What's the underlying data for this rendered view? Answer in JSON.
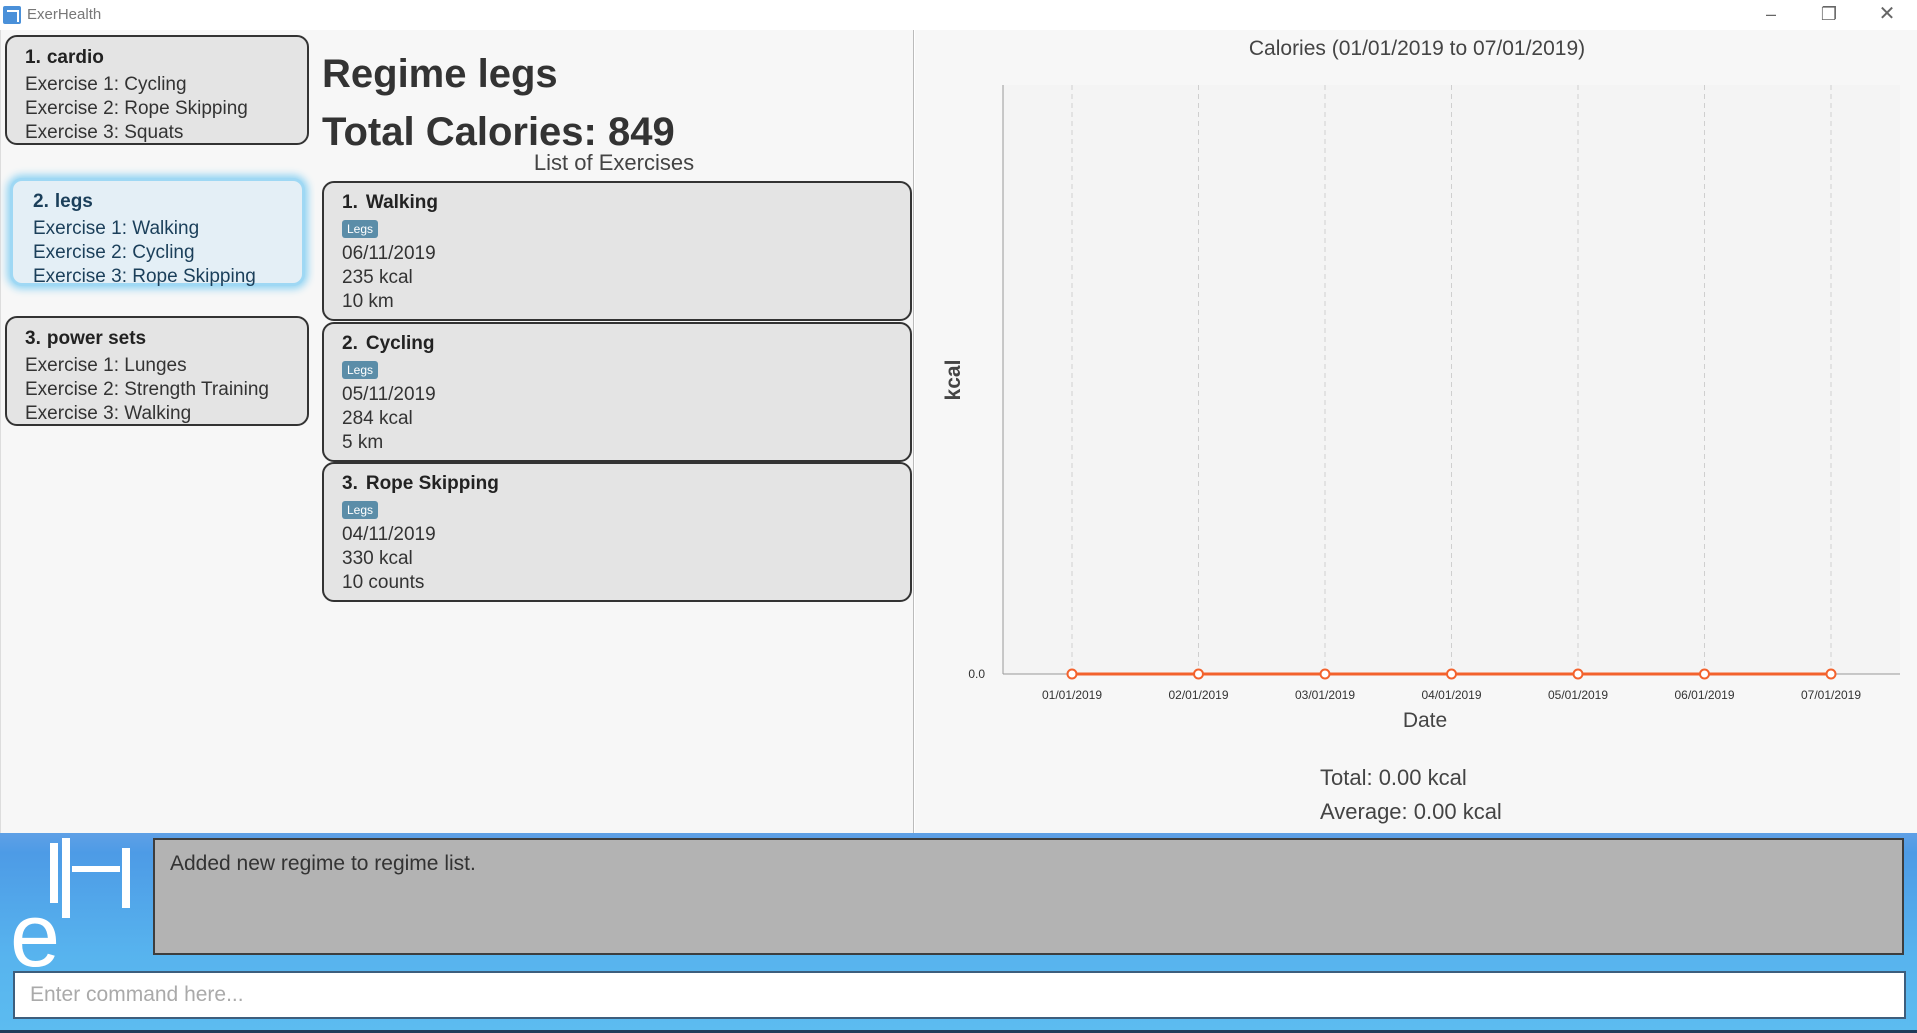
{
  "window": {
    "title": "ExerHealth",
    "minimize": "–",
    "maximize": "❐",
    "close": "✕"
  },
  "regimes": [
    {
      "num": "1.",
      "name": "cardio",
      "exercises": [
        "Exercise 1: Cycling",
        "Exercise 2: Rope Skipping",
        "Exercise 3: Squats"
      ]
    },
    {
      "num": "2.",
      "name": "legs",
      "exercises": [
        "Exercise 1: Walking",
        "Exercise 2: Cycling",
        "Exercise 3: Rope Skipping"
      ],
      "selected": true
    },
    {
      "num": "3.",
      "name": "power sets",
      "exercises": [
        "Exercise 1: Lunges",
        "Exercise 2: Strength Training",
        "Exercise 3: Walking"
      ]
    }
  ],
  "detail": {
    "regime_title": "Regime legs",
    "total_calories": "Total Calories: 849",
    "list_heading": "List of Exercises",
    "exercises": [
      {
        "num": "1.",
        "name": "Walking",
        "tag": "Legs",
        "date": "06/11/2019",
        "calories": "235 kcal",
        "quantity": "10 km"
      },
      {
        "num": "2.",
        "name": "Cycling",
        "tag": "Legs",
        "date": "05/11/2019",
        "calories": "284 kcal",
        "quantity": "5 km"
      },
      {
        "num": "3.",
        "name": "Rope Skipping",
        "tag": "Legs",
        "date": "04/11/2019",
        "calories": "330 kcal",
        "quantity": "10 counts"
      }
    ]
  },
  "chart_data": {
    "type": "line",
    "title": "Calories (01/01/2019 to 07/01/2019)",
    "xlabel": "Date",
    "ylabel": "kcal",
    "categories": [
      "01/01/2019",
      "02/01/2019",
      "03/01/2019",
      "04/01/2019",
      "05/01/2019",
      "06/01/2019",
      "07/01/2019"
    ],
    "values": [
      0,
      0,
      0,
      0,
      0,
      0,
      0
    ],
    "y_tick_labels": [
      "0.0"
    ],
    "grid": "vertical dashed",
    "legend": "none",
    "line_color": "#f3622d"
  },
  "summary": {
    "total": "Total: 0.00 kcal",
    "average": "Average: 0.00 kcal"
  },
  "result_display": "Added new regime to regime list.",
  "command_box": {
    "placeholder": "Enter command here..."
  },
  "colors": {
    "accent": "#5cbcf0",
    "selected_glow": "#8fd3f3",
    "tag_bg": "#5b8da8"
  }
}
